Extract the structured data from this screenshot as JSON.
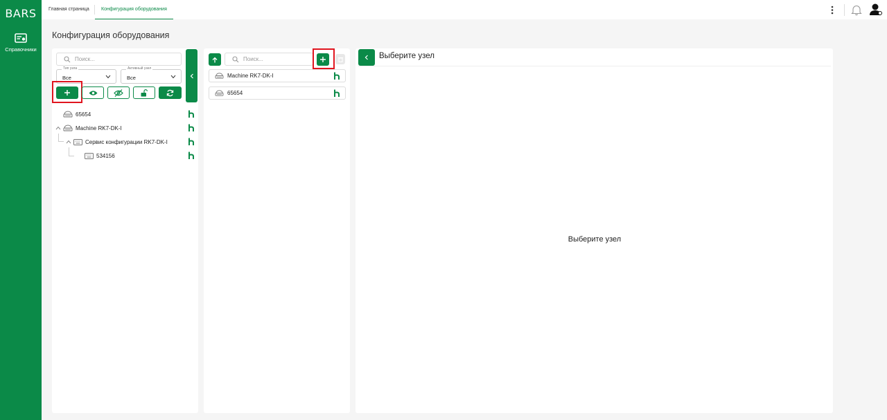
{
  "app": {
    "logo": "BARS"
  },
  "sidebar": {
    "items": [
      {
        "label": "Справочники",
        "icon": "card-icon"
      }
    ]
  },
  "tabs": [
    {
      "label": "Главная страница",
      "active": false
    },
    {
      "label": "Конфигурация оборудования",
      "active": true
    }
  ],
  "header_icons": [
    "more-vert-icon",
    "bell-icon",
    "user-avatar-icon"
  ],
  "page": {
    "title": "Конфигурация оборудования"
  },
  "left_panel": {
    "search_placeholder": "Поиск...",
    "filters": [
      {
        "label": "Тип узла",
        "value": "Все"
      },
      {
        "label": "Активный узел",
        "value": "Все"
      }
    ],
    "toolbar": [
      "add-icon",
      "eye-icon",
      "eye-off-icon",
      "unlock-icon",
      "refresh-icon"
    ],
    "tree": [
      {
        "label": "65654",
        "level": 0,
        "expandable": false,
        "icon": "server-icon"
      },
      {
        "label": "Machine RK7-DK-I",
        "level": 0,
        "expandable": true,
        "expanded": true,
        "icon": "server-icon"
      },
      {
        "label": "Сервис конфигурации RK7-DK-I",
        "level": 1,
        "expandable": true,
        "expanded": true,
        "icon": "keyboard-icon"
      },
      {
        "label": "534156",
        "level": 2,
        "expandable": false,
        "icon": "keyboard-icon"
      }
    ]
  },
  "middle_panel": {
    "search_placeholder": "Поиск...",
    "items": [
      {
        "label": "Machine RK7-DK-I",
        "icon": "server-icon"
      },
      {
        "label": "65654",
        "icon": "server-icon"
      }
    ]
  },
  "right_panel": {
    "title": "Выберите узел",
    "empty_message": "Выберите узел"
  },
  "colors": {
    "brand": "#0b8a48",
    "highlight": "#e0141e",
    "background": "#f5f5f5"
  }
}
